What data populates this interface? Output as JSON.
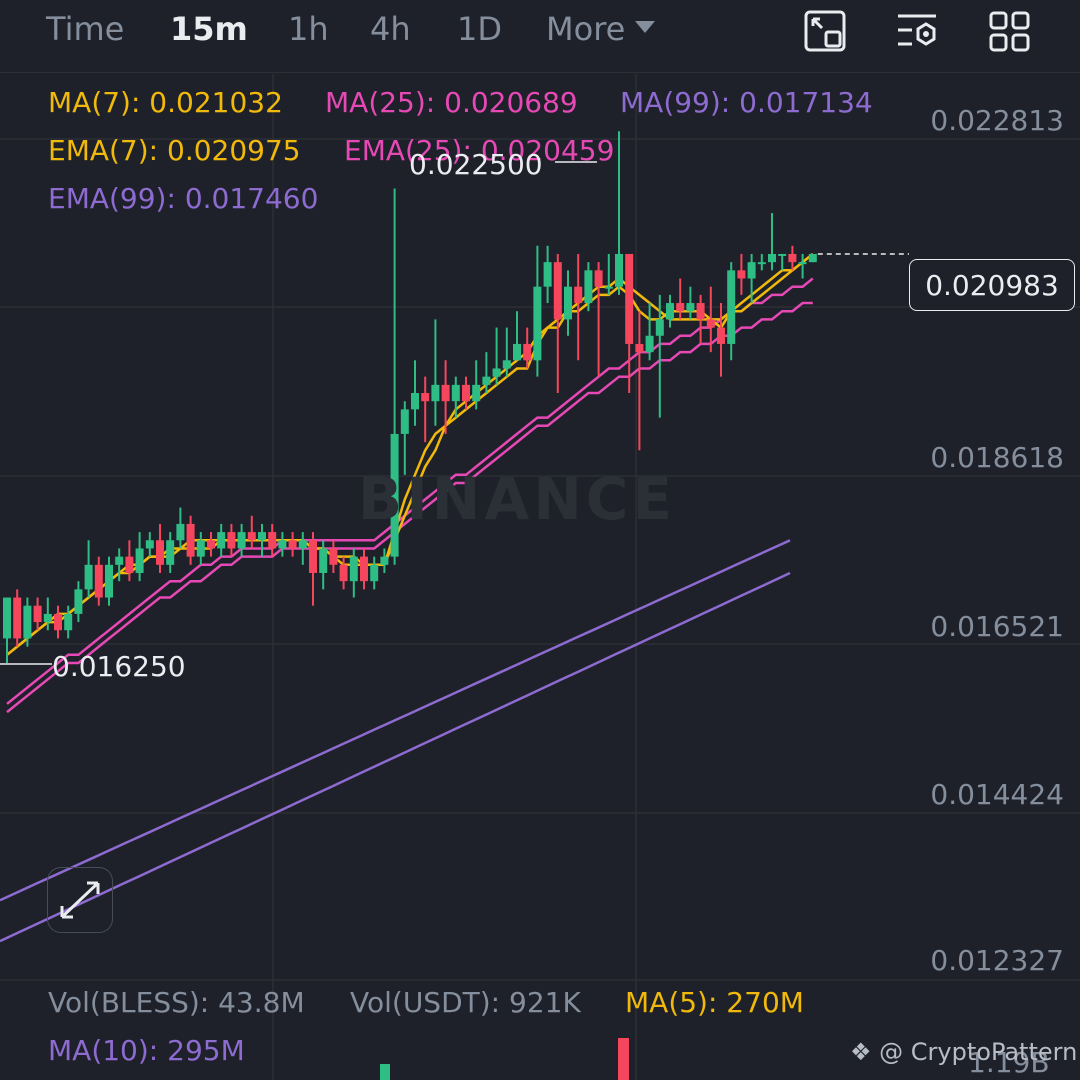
{
  "colors": {
    "background": "#1e2129",
    "up": "#2ebd85",
    "down": "#f6465d",
    "ma7": "#f0b90b",
    "ma25": "#e649b5",
    "ma99": "#8e6bd1"
  },
  "toolbar": {
    "tabs": [
      "Time",
      "15m",
      "1h",
      "4h",
      "1D"
    ],
    "active_tab": "15m",
    "more_label": "More",
    "icons": [
      "chart-window-icon",
      "chart-settings-icon",
      "grid-layout-icon"
    ]
  },
  "indicators": {
    "ma7": "MA(7): 0.021032",
    "ma25": "MA(25): 0.020689",
    "ma99": "MA(99): 0.017134",
    "ema7": "EMA(7): 0.020975",
    "ema25": "EMA(25): 0.020459",
    "ema99": "EMA(99): 0.017460"
  },
  "price_axis": [
    "0.022813",
    "0.018618",
    "0.016521",
    "0.014424",
    "0.012327"
  ],
  "current_price": "0.020983",
  "annotations": {
    "high": "0.022500",
    "low": "0.016250"
  },
  "watermark": "BINANCE",
  "volume": {
    "vol_base": "Vol(BLESS): 43.8M",
    "vol_quote": "Vol(USDT): 921K",
    "ma5": "MA(5): 270M",
    "ma10": "MA(10): 295M",
    "axis_label": "1.19B"
  },
  "credit": "@ CryptoPattern",
  "chart_data": {
    "type": "candlestick",
    "ylim": [
      0.0121,
      0.0232
    ],
    "candles": [
      [
        0.0163,
        0.0168,
        0.0168,
        0.016
      ],
      [
        0.0168,
        0.0163,
        0.0169,
        0.0162
      ],
      [
        0.0163,
        0.0167,
        0.0168,
        0.0162
      ],
      [
        0.0167,
        0.0165,
        0.0168,
        0.0164
      ],
      [
        0.0165,
        0.0166,
        0.0168,
        0.0164
      ],
      [
        0.0166,
        0.0164,
        0.0167,
        0.0163
      ],
      [
        0.0164,
        0.0166,
        0.0167,
        0.0163
      ],
      [
        0.0166,
        0.0169,
        0.017,
        0.0165
      ],
      [
        0.0169,
        0.0172,
        0.0175,
        0.0168
      ],
      [
        0.0172,
        0.0168,
        0.0173,
        0.0167
      ],
      [
        0.0168,
        0.0172,
        0.0173,
        0.0167
      ],
      [
        0.0172,
        0.0173,
        0.0174,
        0.017
      ],
      [
        0.0173,
        0.0171,
        0.0175,
        0.017
      ],
      [
        0.0171,
        0.0174,
        0.0176,
        0.017
      ],
      [
        0.0174,
        0.0175,
        0.0176,
        0.0173
      ],
      [
        0.0175,
        0.0172,
        0.0177,
        0.0171
      ],
      [
        0.0172,
        0.0175,
        0.0176,
        0.0171
      ],
      [
        0.0175,
        0.0177,
        0.0179,
        0.0174
      ],
      [
        0.0177,
        0.0173,
        0.0178,
        0.0172
      ],
      [
        0.0173,
        0.0175,
        0.0176,
        0.0172
      ],
      [
        0.0175,
        0.0174,
        0.0176,
        0.0173
      ],
      [
        0.0174,
        0.0176,
        0.0177,
        0.0173
      ],
      [
        0.0176,
        0.0174,
        0.0177,
        0.0173
      ],
      [
        0.0174,
        0.0176,
        0.0177,
        0.0173
      ],
      [
        0.0176,
        0.0175,
        0.0178,
        0.0174
      ],
      [
        0.0175,
        0.0176,
        0.0177,
        0.0173
      ],
      [
        0.0176,
        0.0174,
        0.0177,
        0.0173
      ],
      [
        0.0174,
        0.0175,
        0.0176,
        0.0173
      ],
      [
        0.0175,
        0.0174,
        0.0176,
        0.0173
      ],
      [
        0.0174,
        0.0175,
        0.0176,
        0.0172
      ],
      [
        0.0175,
        0.0171,
        0.0176,
        0.0167
      ],
      [
        0.0171,
        0.0174,
        0.0175,
        0.0169
      ],
      [
        0.0174,
        0.0172,
        0.0175,
        0.0171
      ],
      [
        0.0172,
        0.017,
        0.0173,
        0.0169
      ],
      [
        0.017,
        0.0173,
        0.0174,
        0.0168
      ],
      [
        0.0173,
        0.017,
        0.0174,
        0.0169
      ],
      [
        0.017,
        0.0172,
        0.0173,
        0.0169
      ],
      [
        0.0172,
        0.0173,
        0.0174,
        0.0171
      ],
      [
        0.0173,
        0.0188,
        0.0218,
        0.0172
      ],
      [
        0.0188,
        0.0191,
        0.0192,
        0.0183
      ],
      [
        0.0191,
        0.0193,
        0.0197,
        0.0189
      ],
      [
        0.0193,
        0.0192,
        0.0195,
        0.0187
      ],
      [
        0.0192,
        0.0194,
        0.0202,
        0.0189
      ],
      [
        0.0194,
        0.0192,
        0.0197,
        0.0188
      ],
      [
        0.0192,
        0.0194,
        0.0195,
        0.019
      ],
      [
        0.0194,
        0.0192,
        0.0195,
        0.0191
      ],
      [
        0.0192,
        0.0194,
        0.0197,
        0.0191
      ],
      [
        0.0194,
        0.0195,
        0.0198,
        0.0193
      ],
      [
        0.0195,
        0.0196,
        0.0201,
        0.0194
      ],
      [
        0.0196,
        0.0197,
        0.0201,
        0.0195
      ],
      [
        0.0197,
        0.0199,
        0.0203,
        0.0197
      ],
      [
        0.0199,
        0.0197,
        0.0201,
        0.0196
      ],
      [
        0.0197,
        0.0206,
        0.0211,
        0.0195
      ],
      [
        0.0206,
        0.0209,
        0.0211,
        0.0204
      ],
      [
        0.0209,
        0.0202,
        0.021,
        0.0193
      ],
      [
        0.0202,
        0.0206,
        0.0208,
        0.02
      ],
      [
        0.0206,
        0.0204,
        0.021,
        0.0197
      ],
      [
        0.0204,
        0.0208,
        0.0209,
        0.0203
      ],
      [
        0.0208,
        0.0206,
        0.0209,
        0.0195
      ],
      [
        0.0206,
        0.0206,
        0.021,
        0.0205
      ],
      [
        0.0206,
        0.021,
        0.0225,
        0.0205
      ],
      [
        0.021,
        0.0199,
        0.021,
        0.0193
      ],
      [
        0.0199,
        0.0198,
        0.0203,
        0.0186
      ],
      [
        0.0198,
        0.02,
        0.0204,
        0.0197
      ],
      [
        0.02,
        0.0202,
        0.0205,
        0.019
      ],
      [
        0.0202,
        0.0204,
        0.0205,
        0.0201
      ],
      [
        0.0204,
        0.0203,
        0.0207,
        0.0202
      ],
      [
        0.0203,
        0.0204,
        0.0206,
        0.0202
      ],
      [
        0.0204,
        0.0202,
        0.0205,
        0.0199
      ],
      [
        0.0202,
        0.0201,
        0.0206,
        0.0198
      ],
      [
        0.0201,
        0.0199,
        0.0204,
        0.0195
      ],
      [
        0.0199,
        0.0208,
        0.0209,
        0.0197
      ],
      [
        0.0208,
        0.0207,
        0.021,
        0.0205
      ],
      [
        0.0207,
        0.0209,
        0.021,
        0.0204
      ],
      [
        0.0209,
        0.0209,
        0.021,
        0.0208
      ],
      [
        0.0209,
        0.021,
        0.0215,
        0.0208
      ],
      [
        0.021,
        0.021,
        0.021,
        0.0208
      ],
      [
        0.021,
        0.0209,
        0.0211,
        0.0208
      ],
      [
        0.0209,
        0.0209,
        0.021,
        0.0207
      ],
      [
        0.0209,
        0.021,
        0.021,
        0.0209
      ]
    ],
    "ma7": [
      0.0161,
      0.0162,
      0.0163,
      0.0164,
      0.0165,
      0.0166,
      0.0166,
      0.0167,
      0.0168,
      0.0169,
      0.017,
      0.0171,
      0.0172,
      0.0172,
      0.0173,
      0.0173,
      0.0174,
      0.0174,
      0.0175,
      0.0175,
      0.0175,
      0.0175,
      0.0175,
      0.0175,
      0.0175,
      0.0175,
      0.0175,
      0.0175,
      0.0175,
      0.0175,
      0.0174,
      0.0174,
      0.0173,
      0.0173,
      0.0173,
      0.0172,
      0.0172,
      0.0172,
      0.0175,
      0.0178,
      0.0181,
      0.0184,
      0.0186,
      0.0189,
      0.0191,
      0.0192,
      0.0193,
      0.0194,
      0.0195,
      0.0196,
      0.0197,
      0.0198,
      0.02,
      0.0201,
      0.0202,
      0.0203,
      0.0204,
      0.0205,
      0.0206,
      0.0206,
      0.0207,
      0.0206,
      0.0205,
      0.0204,
      0.0203,
      0.0202,
      0.0202,
      0.0202,
      0.0202,
      0.0202,
      0.0202,
      0.0203,
      0.0203,
      0.0204,
      0.0205,
      0.0206,
      0.0207,
      0.0208,
      0.0209,
      0.021
    ],
    "ema7": [
      0.0161,
      0.0162,
      0.0163,
      0.0164,
      0.0165,
      0.0165,
      0.0166,
      0.0167,
      0.0168,
      0.0169,
      0.017,
      0.0171,
      0.0171,
      0.0172,
      0.0173,
      0.0173,
      0.0173,
      0.0174,
      0.0174,
      0.0174,
      0.0174,
      0.0175,
      0.0175,
      0.0175,
      0.0175,
      0.0175,
      0.0175,
      0.0175,
      0.0175,
      0.0175,
      0.0174,
      0.0174,
      0.0173,
      0.0172,
      0.0172,
      0.0172,
      0.0172,
      0.0172,
      0.0176,
      0.018,
      0.0183,
      0.0186,
      0.0188,
      0.0189,
      0.019,
      0.0191,
      0.0192,
      0.0193,
      0.0194,
      0.0195,
      0.0196,
      0.0196,
      0.0199,
      0.0201,
      0.0201,
      0.0203,
      0.0203,
      0.0204,
      0.0205,
      0.0205,
      0.0206,
      0.0205,
      0.0203,
      0.0202,
      0.0202,
      0.0203,
      0.0203,
      0.0203,
      0.0203,
      0.0202,
      0.0201,
      0.0203,
      0.0204,
      0.0205,
      0.0206,
      0.0207,
      0.0208,
      0.0208,
      0.0209,
      0.021
    ],
    "ma25": [
      0.0155,
      0.0156,
      0.0157,
      0.0158,
      0.0159,
      0.016,
      0.0161,
      0.0161,
      0.0162,
      0.0163,
      0.0164,
      0.0165,
      0.0166,
      0.0167,
      0.0168,
      0.0169,
      0.017,
      0.017,
      0.0171,
      0.0172,
      0.0172,
      0.0173,
      0.0173,
      0.0174,
      0.0174,
      0.0174,
      0.0174,
      0.0175,
      0.0175,
      0.0175,
      0.0175,
      0.0175,
      0.0175,
      0.0175,
      0.0175,
      0.0175,
      0.0175,
      0.0176,
      0.0177,
      0.0178,
      0.0179,
      0.018,
      0.0181,
      0.0182,
      0.0183,
      0.0183,
      0.0184,
      0.0185,
      0.0186,
      0.0187,
      0.0188,
      0.0189,
      0.019,
      0.019,
      0.0191,
      0.0192,
      0.0193,
      0.0194,
      0.0195,
      0.0196,
      0.0196,
      0.0197,
      0.0198,
      0.0198,
      0.0199,
      0.0199,
      0.02,
      0.02,
      0.0201,
      0.0201,
      0.0202,
      0.0203,
      0.0203,
      0.0204,
      0.0204,
      0.0205,
      0.0205,
      0.0206,
      0.0206,
      0.0207
    ],
    "ema25": [
      0.0154,
      0.0155,
      0.0156,
      0.0157,
      0.0158,
      0.0159,
      0.016,
      0.016,
      0.0161,
      0.0162,
      0.0163,
      0.0164,
      0.0165,
      0.0166,
      0.0167,
      0.0168,
      0.0168,
      0.0169,
      0.017,
      0.017,
      0.0171,
      0.0172,
      0.0172,
      0.0173,
      0.0173,
      0.0173,
      0.0173,
      0.0174,
      0.0174,
      0.0174,
      0.0174,
      0.0174,
      0.0174,
      0.0174,
      0.0174,
      0.0174,
      0.0174,
      0.0175,
      0.0176,
      0.0177,
      0.0178,
      0.0179,
      0.018,
      0.0181,
      0.0182,
      0.0182,
      0.0183,
      0.0184,
      0.0185,
      0.0186,
      0.0187,
      0.0188,
      0.0189,
      0.0189,
      0.019,
      0.0191,
      0.0192,
      0.0193,
      0.0193,
      0.0194,
      0.0195,
      0.0195,
      0.0196,
      0.0196,
      0.0197,
      0.0197,
      0.0198,
      0.0198,
      0.0199,
      0.0199,
      0.02,
      0.02,
      0.0201,
      0.0201,
      0.0202,
      0.0202,
      0.0203,
      0.0203,
      0.0204,
      0.0204
    ],
    "ma99": [
      0.0126,
      0.0127,
      0.0128,
      0.0129,
      0.013,
      0.0131,
      0.0132,
      0.0133,
      0.0134,
      0.0135,
      0.0136,
      0.0137,
      0.0138,
      0.0139,
      0.014,
      0.0141,
      0.0142,
      0.0143,
      0.0144,
      0.0145,
      0.0146,
      0.0147,
      0.0148,
      0.0149,
      0.015,
      0.0151,
      0.0152,
      0.0153,
      0.0154,
      0.0155,
      0.0156,
      0.0157,
      0.0158,
      0.0159,
      0.016,
      0.0161,
      0.0162,
      0.0163,
      0.0164,
      0.0165,
      0.0166,
      0.0167,
      0.0168,
      0.0169,
      0.017,
      0.0171
    ],
    "ema99": [
      0.0131,
      0.0132,
      0.0133,
      0.0134,
      0.0135,
      0.0136,
      0.0137,
      0.0138,
      0.0139,
      0.014,
      0.0141,
      0.0142,
      0.0143,
      0.0144,
      0.0145,
      0.0146,
      0.0147,
      0.0148,
      0.0149,
      0.015,
      0.0151,
      0.0152,
      0.0153,
      0.0154,
      0.0155,
      0.0156,
      0.0157,
      0.0158,
      0.0159,
      0.016,
      0.0161,
      0.0162,
      0.0163,
      0.0164,
      0.0165,
      0.0166,
      0.0167,
      0.0168,
      0.0169,
      0.017,
      0.0171,
      0.0172,
      0.0173,
      0.0174,
      0.0175
    ]
  }
}
